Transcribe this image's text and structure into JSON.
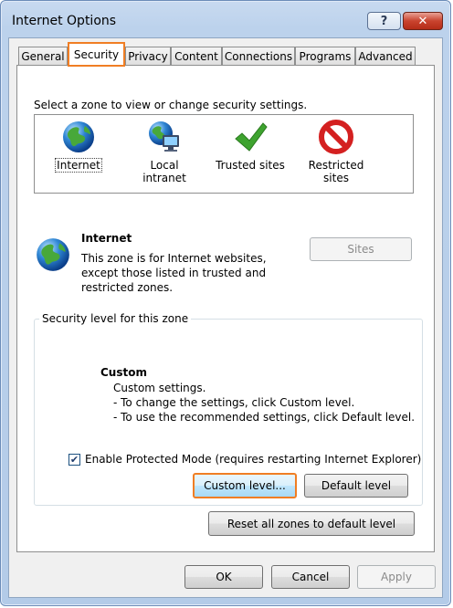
{
  "window": {
    "title": "Internet Options"
  },
  "title_buttons": {
    "help": "?",
    "close": "✕"
  },
  "tabs": [
    {
      "label": "General"
    },
    {
      "label": "Security"
    },
    {
      "label": "Privacy"
    },
    {
      "label": "Content"
    },
    {
      "label": "Connections"
    },
    {
      "label": "Programs"
    },
    {
      "label": "Advanced"
    }
  ],
  "zones": {
    "prompt": "Select a zone to view or change security settings.",
    "items": [
      {
        "label": "Internet",
        "icon": "globe-icon"
      },
      {
        "label": "Local intranet",
        "icon": "intranet-icon"
      },
      {
        "label": "Trusted sites",
        "icon": "checkmark-icon"
      },
      {
        "label": "Restricted sites",
        "icon": "no-entry-icon"
      }
    ]
  },
  "zone_detail": {
    "name": "Internet",
    "desc1": "This zone is for Internet websites,",
    "desc2": "except those listed in trusted and",
    "desc3": "restricted zones.",
    "sites_button": "Sites"
  },
  "security_level": {
    "legend": "Security level for this zone",
    "level_name": "Custom",
    "line1": "Custom settings.",
    "line2": "- To change the settings, click Custom level.",
    "line3": "- To use the recommended settings, click Default level.",
    "protected_mode_label": "Enable Protected Mode (requires restarting Internet Explorer)",
    "protected_mode_checked": true,
    "custom_level_button": "Custom level...",
    "default_level_button": "Default level"
  },
  "reset_button": "Reset all zones to default level",
  "footer": {
    "ok": "OK",
    "cancel": "Cancel",
    "apply": "Apply"
  },
  "colors": {
    "highlight": "#f07e24",
    "titlebar": "#bcd2ec",
    "close": "#c9432e"
  }
}
